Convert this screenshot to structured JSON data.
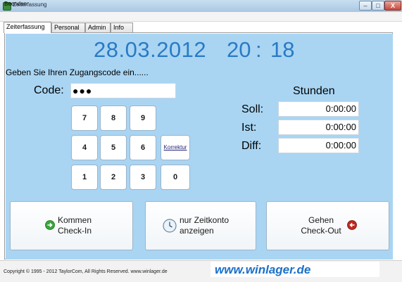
{
  "window": {
    "title": "Zeiterfassung",
    "min": "–",
    "max": "□",
    "close": "X"
  },
  "menu": {
    "beenden": "Beenden"
  },
  "tabs": [
    {
      "label": "Zeiterfassung"
    },
    {
      "label": "Personal"
    },
    {
      "label": "Admin"
    },
    {
      "label": "Info"
    }
  ],
  "clock": {
    "date": "28.03.2012",
    "hour": "20",
    "colon": ":",
    "minute": "18"
  },
  "prompt": "Geben Sie Ihren Zugangscode ein......",
  "code": {
    "label": "Code:",
    "value": "●●●"
  },
  "keypad": {
    "k7": "7",
    "k8": "8",
    "k9": "9",
    "k4": "4",
    "k5": "5",
    "k6": "6",
    "korrektur": "Korrektur",
    "k1": "1",
    "k2": "2",
    "k3": "3",
    "k0": "0"
  },
  "hours": {
    "title": "Stunden",
    "soll_label": "Soll:",
    "soll_value": "0:00:00",
    "ist_label": "Ist:",
    "ist_value": "0:00:00",
    "diff_label": "Diff:",
    "diff_value": "0:00:00"
  },
  "actions": {
    "kommen_line1": "Kommen",
    "kommen_line2": "Check-In",
    "zeitkonto_line1": "nur Zeitkonto",
    "zeitkonto_line2": "anzeigen",
    "gehen_line1": "Gehen",
    "gehen_line2": "Check-Out"
  },
  "footer": {
    "copyright": "Copyright © 1995 - 2012  TaylorCom, All Rights Reserved.  www.winlager.de",
    "brand": "www.winlager.de"
  },
  "colors": {
    "accent_text": "#2a7ac4",
    "panel_bg": "#a9d5f3",
    "brand": "#1a70c8",
    "checkin": "#3aa63a",
    "checkout": "#c0281e"
  },
  "icons": {
    "checkin": "arrow-right-circle-icon",
    "zeitkonto": "clock-icon",
    "checkout": "arrow-left-circle-icon"
  }
}
